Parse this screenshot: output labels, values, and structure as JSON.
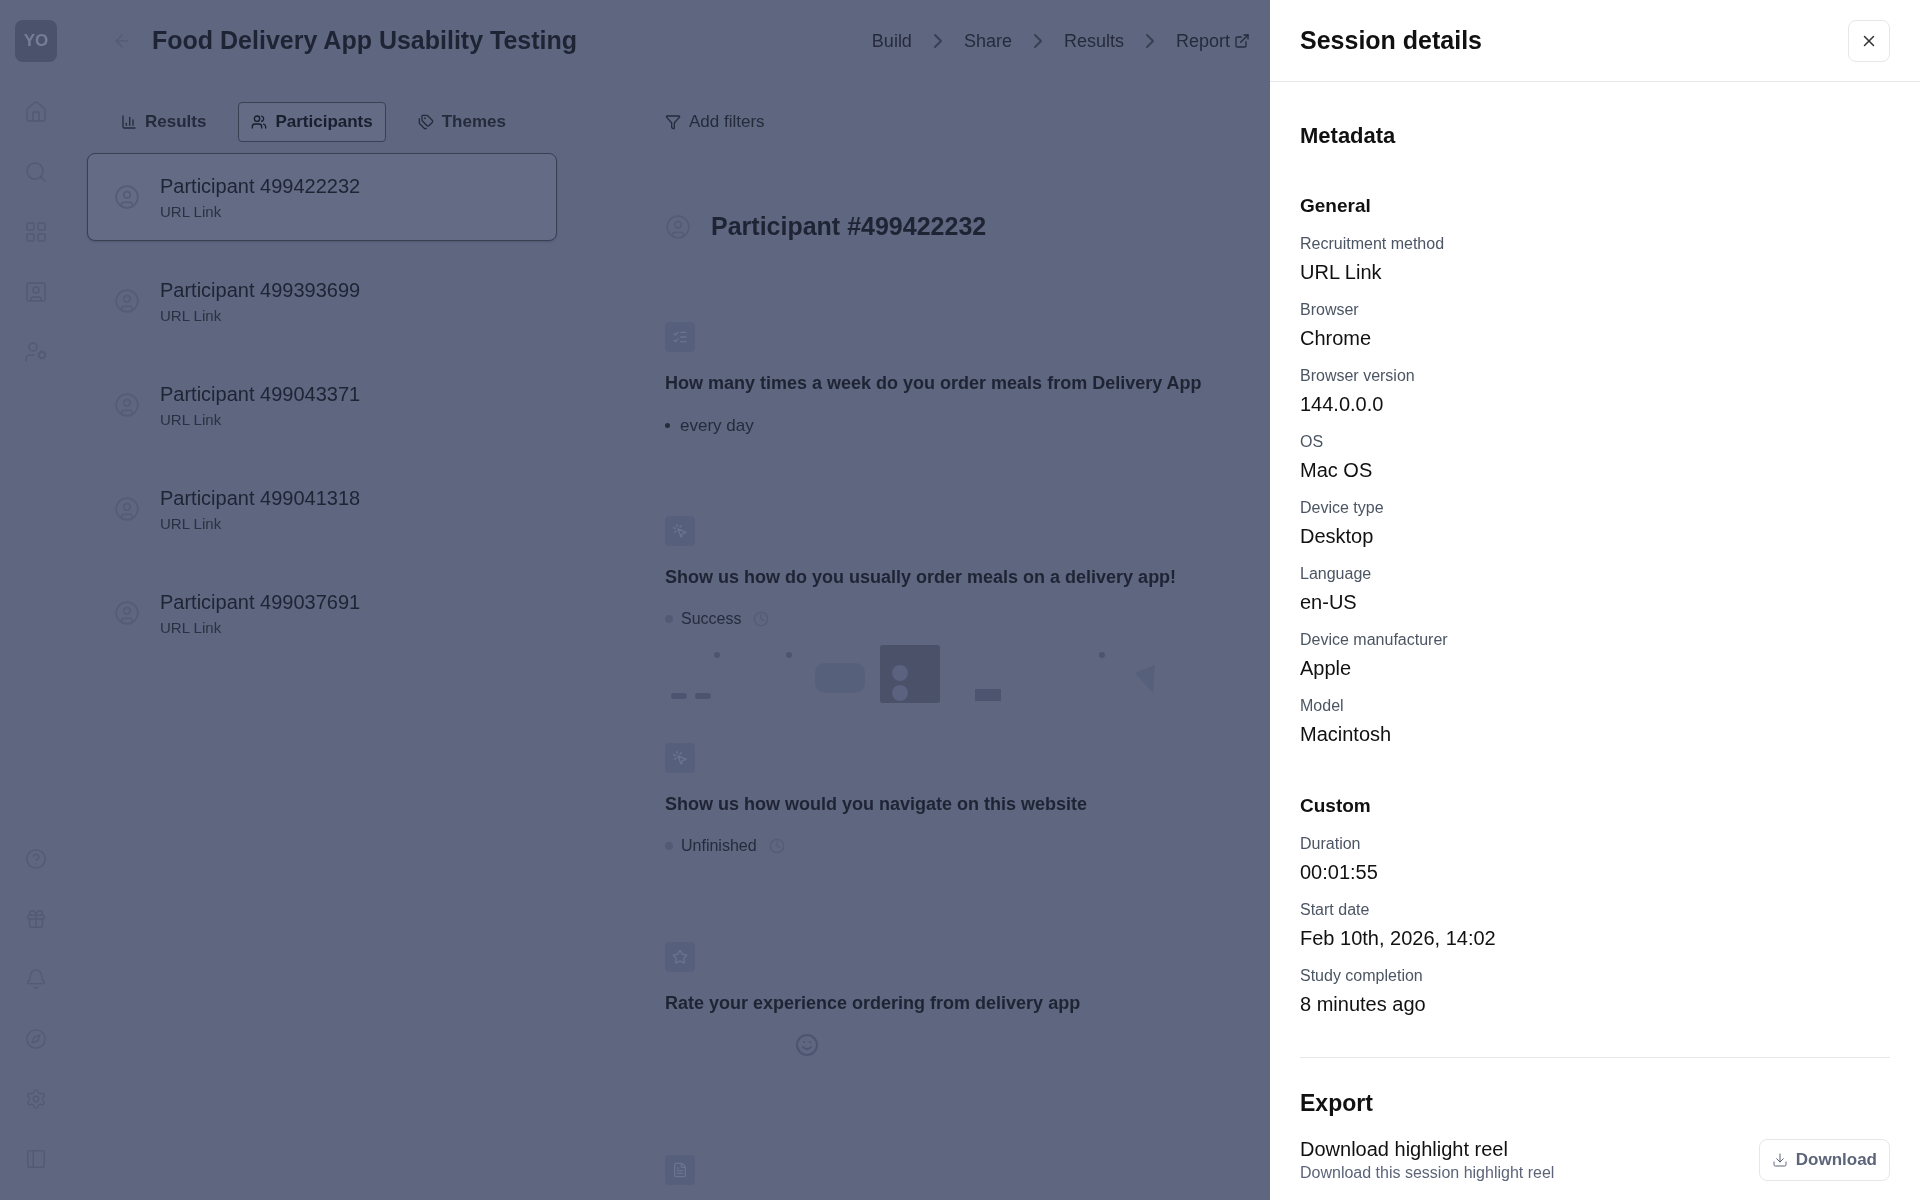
{
  "sidebar": {
    "avatar": "YO"
  },
  "header": {
    "title": "Food Delivery App Usability Testing",
    "steps": [
      {
        "label": "Build",
        "kind": "step"
      },
      {
        "label": "Share",
        "kind": "step"
      },
      {
        "label": "Results",
        "kind": "step"
      },
      {
        "label": "Report",
        "kind": "external"
      }
    ]
  },
  "tabs": [
    {
      "label": "Results",
      "selected": false
    },
    {
      "label": "Participants",
      "selected": true
    },
    {
      "label": "Themes",
      "selected": false
    }
  ],
  "filter": "Add filters",
  "participants": [
    {
      "name": "Participant 499422232",
      "source": "URL Link",
      "selected": true
    },
    {
      "name": "Participant 499393699",
      "source": "URL Link",
      "selected": false
    },
    {
      "name": "Participant 499043371",
      "source": "URL Link",
      "selected": false
    },
    {
      "name": "Participant 499041318",
      "source": "URL Link",
      "selected": false
    },
    {
      "name": "Participant 499037691",
      "source": "URL Link",
      "selected": false
    }
  ],
  "detail": {
    "title": "Participant #499422232",
    "blocks": [
      {
        "kind": "choice",
        "question": "How many times a week do you order meals from Delivery App",
        "answer": "every day"
      },
      {
        "kind": "task",
        "question": "Show us how do you usually order meals on a delivery app!",
        "status": "Success",
        "thumbnails": true
      },
      {
        "kind": "task",
        "question": "Show us how would you navigate on this website",
        "status": "Unfinished",
        "thumbnails": false
      },
      {
        "kind": "rating",
        "question": "Rate your experience ordering from delivery app"
      },
      {
        "kind": "next"
      }
    ]
  },
  "panel": {
    "title": "Session details",
    "heading": "Metadata",
    "sections": [
      {
        "title": "General",
        "fields": [
          {
            "label": "Recruitment method",
            "value": "URL Link"
          },
          {
            "label": "Browser",
            "value": "Chrome"
          },
          {
            "label": "Browser version",
            "value": "144.0.0.0"
          },
          {
            "label": "OS",
            "value": "Mac OS"
          },
          {
            "label": "Device type",
            "value": "Desktop"
          },
          {
            "label": "Language",
            "value": "en-US"
          },
          {
            "label": "Device manufacturer",
            "value": "Apple"
          },
          {
            "label": "Model",
            "value": "Macintosh"
          }
        ]
      },
      {
        "title": "Custom",
        "fields": [
          {
            "label": "Duration",
            "value": "00:01:55"
          },
          {
            "label": "Start date",
            "value": "Feb 10th, 2026, 14:02"
          },
          {
            "label": "Study completion",
            "value": "8 minutes ago"
          }
        ]
      }
    ],
    "export": {
      "title": "Export",
      "items": [
        {
          "title": "Download highlight reel",
          "description": "Download this session highlight reel",
          "button": "Download"
        }
      ]
    }
  }
}
